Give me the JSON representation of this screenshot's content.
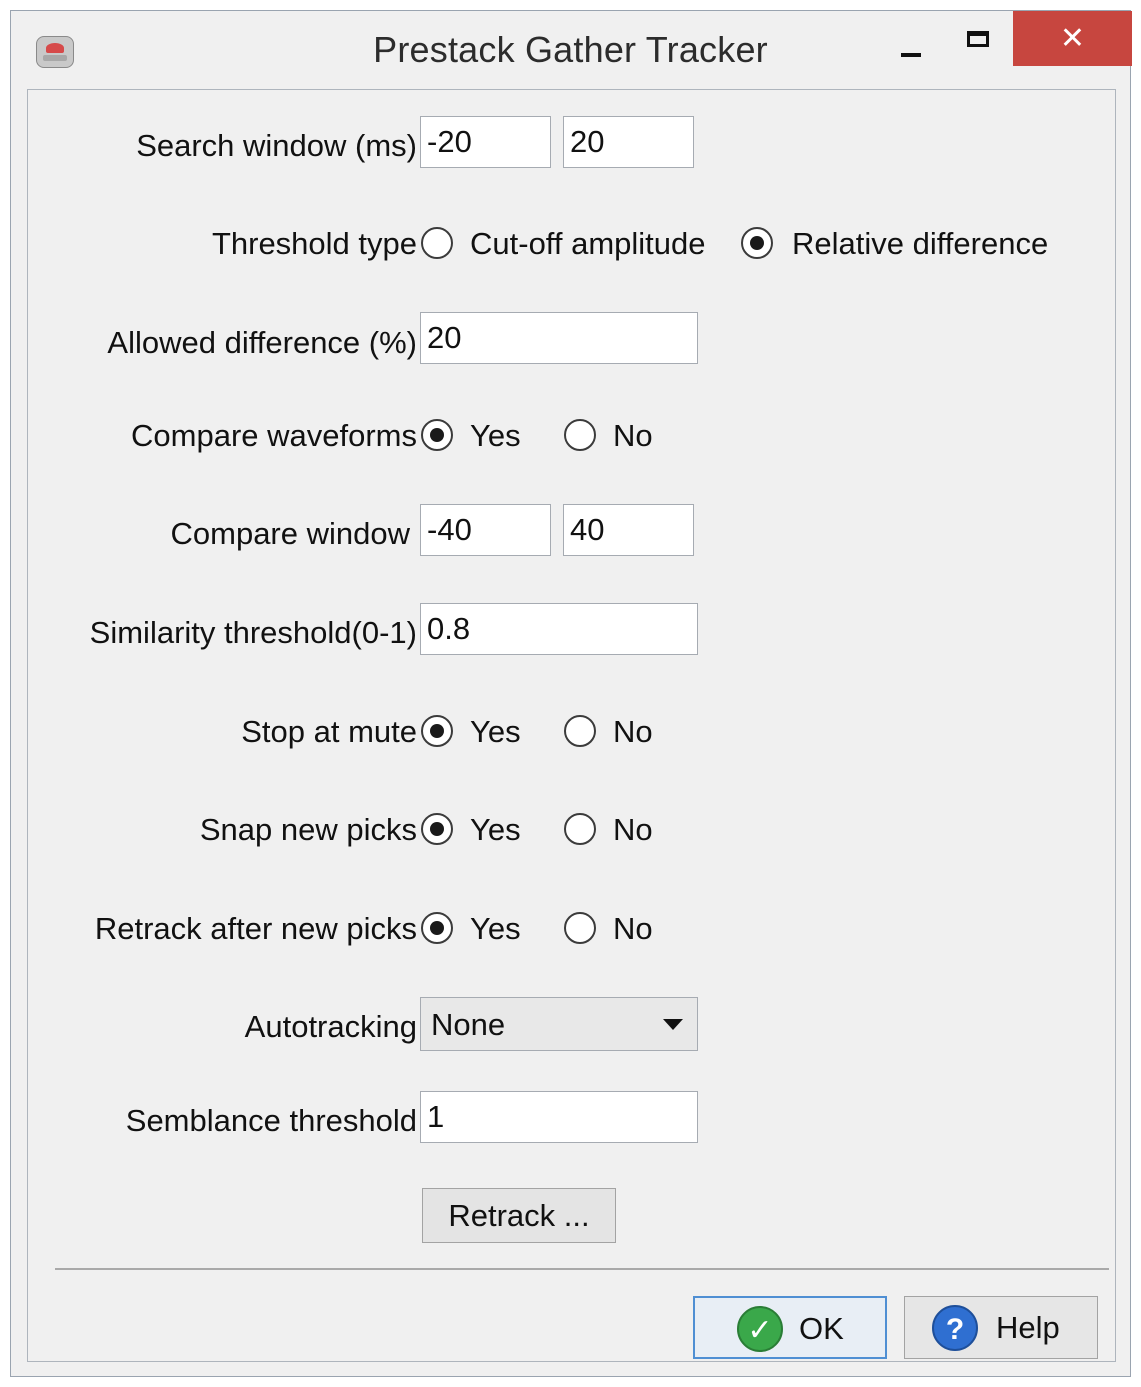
{
  "window": {
    "title": "Prestack Gather Tracker",
    "close_glyph": "✕"
  },
  "form": {
    "search_window": {
      "label": "Search window (ms)",
      "from": "-20",
      "to": "20"
    },
    "threshold_type": {
      "label": "Threshold type",
      "options": [
        "Cut-off amplitude",
        "Relative difference"
      ],
      "selected": "Relative difference"
    },
    "allowed_difference": {
      "label": "Allowed difference (%)",
      "value": "20"
    },
    "compare_waveforms": {
      "label": "Compare waveforms",
      "yes": "Yes",
      "no": "No",
      "selected": "Yes"
    },
    "compare_window": {
      "label": "Compare window",
      "from": "-40",
      "to": "40"
    },
    "similarity_threshold": {
      "label": "Similarity threshold(0-1)",
      "value": "0.8"
    },
    "stop_at_mute": {
      "label": "Stop at mute",
      "yes": "Yes",
      "no": "No",
      "selected": "Yes"
    },
    "snap_new_picks": {
      "label": "Snap new picks",
      "yes": "Yes",
      "no": "No",
      "selected": "Yes"
    },
    "retrack_after_new_picks": {
      "label": "Retrack after new picks",
      "yes": "Yes",
      "no": "No",
      "selected": "Yes"
    },
    "autotracking": {
      "label": "Autotracking",
      "value": "None"
    },
    "semblance_threshold": {
      "label": "Semblance threshold",
      "value": "1"
    },
    "retrack_button": "Retrack ..."
  },
  "footer": {
    "ok_label": "OK",
    "help_label": "Help",
    "ok_icon": "check-icon",
    "help_icon": "question-icon",
    "ok_icon_glyph": "✓",
    "help_icon_glyph": "?"
  },
  "colors": {
    "close_button": "#c7463f",
    "ok_border": "#4f8fd3",
    "ok_icon": "#3aa84a",
    "help_icon": "#2f6fd1"
  }
}
